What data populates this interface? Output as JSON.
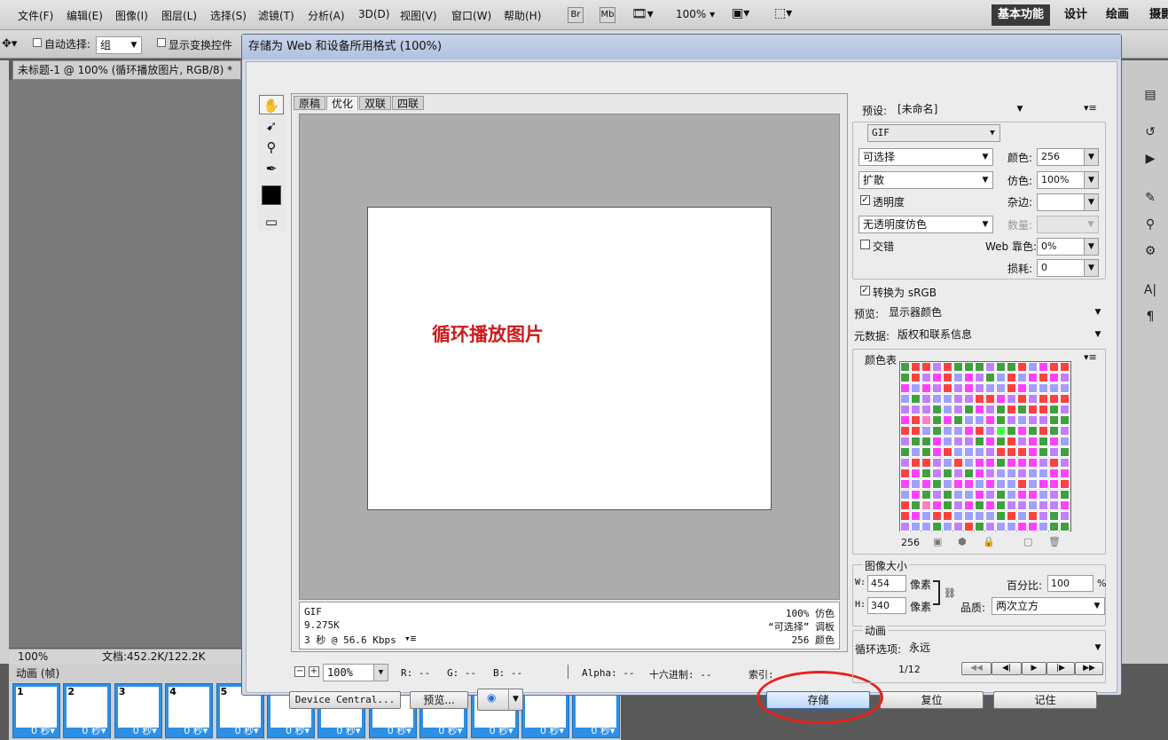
{
  "menubar": {
    "items": [
      "文件(F)",
      "编辑(E)",
      "图像(I)",
      "图层(L)",
      "选择(S)",
      "滤镜(T)",
      "分析(A)",
      "3D(D)",
      "视图(V)",
      "窗口(W)",
      "帮助(H)"
    ],
    "br": "Br",
    "mb": "Mb",
    "zoom": "100%",
    "workspaces": [
      "基本功能",
      "设计",
      "绘画",
      "摄影"
    ]
  },
  "options": {
    "auto_select_label": "自动选择:",
    "auto_select_value": "组",
    "show_transform_label": "显示变换控件"
  },
  "doc": {
    "tab_title": "未标题-1 @ 100% (循环播放图片, RGB/8) *",
    "zoom": "100%",
    "doc_size": "文档:452.2K/122.2K"
  },
  "anim": {
    "panel_title": "动画 (帧)",
    "frames": [
      {
        "num": "1",
        "delay": "0 秒"
      },
      {
        "num": "2",
        "delay": "0 秒"
      },
      {
        "num": "3",
        "delay": "0 秒"
      },
      {
        "num": "4",
        "delay": "0 秒"
      },
      {
        "num": "5",
        "delay": "0 秒"
      },
      {
        "num": "",
        "delay": "0 秒"
      },
      {
        "num": "",
        "delay": "0 秒"
      },
      {
        "num": "",
        "delay": "0 秒"
      },
      {
        "num": "",
        "delay": "0 秒"
      },
      {
        "num": "",
        "delay": "0 秒"
      },
      {
        "num": "",
        "delay": "0 秒"
      },
      {
        "num": "",
        "delay": "0 秒"
      }
    ]
  },
  "dialog": {
    "title": "存储为 Web 和设备所用格式 (100%)",
    "tabs": [
      "原稿",
      "优化",
      "双联",
      "四联"
    ],
    "active_tab": "优化",
    "canvas_text": "循环播放图片",
    "info": {
      "format": "GIF",
      "size": "9.275K",
      "speed": "3 秒 @ 56.6 Kbps",
      "dither": "100% 仿色",
      "palette": "“可选择” 调板",
      "colors": "256 颜色"
    },
    "statusbar": {
      "zoom": "100%",
      "r": "R: --",
      "g": "G: --",
      "b": "B: --",
      "alpha": "Alpha: --",
      "hex": "十六进制: --",
      "index": "索引:"
    },
    "buttons": {
      "device_central": "Device Central...",
      "preview": "预览...",
      "save": "存储",
      "reset": "复位",
      "remember": "记住"
    },
    "settings": {
      "preset_label": "预设:",
      "preset_value": "[未命名]",
      "format": "GIF",
      "reduction": "可选择",
      "colors_label": "颜色:",
      "colors_value": "256",
      "dither_algo": "扩散",
      "dither_label": "仿色:",
      "dither_value": "100%",
      "transparency_label": "透明度",
      "matte_label": "杂边:",
      "trans_dither": "无透明度仿色",
      "amount_label": "数量:",
      "interlace_label": "交错",
      "web_snap_label": "Web 靠色:",
      "web_snap_value": "0%",
      "lossy_label": "损耗:",
      "lossy_value": "0",
      "srgb_label": "转换为 sRGB",
      "preview_label": "预览:",
      "preview_value": "显示器颜色",
      "metadata_label": "元数据:",
      "metadata_value": "版权和联系信息",
      "color_table_label": "颜色表",
      "color_count": "256",
      "image_size_label": "图像大小",
      "w_label": "W:",
      "w_value": "454",
      "h_label": "H:",
      "h_value": "340",
      "px": "像素",
      "percent_label": "百分比:",
      "percent_value": "100",
      "percent_unit": "%",
      "quality_label": "品质:",
      "quality_value": "两次立方",
      "anim_label": "动画",
      "loop_label": "循环选项:",
      "loop_value": "永远",
      "frame_counter": "1/12"
    }
  },
  "colors": {
    "accent_red": "#e8201c",
    "frame_blue": "#2d8fe6"
  }
}
